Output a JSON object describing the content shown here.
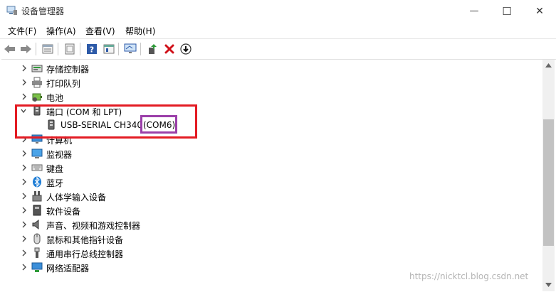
{
  "window": {
    "title": "设备管理器",
    "minimize_glyph": "—",
    "maximize_glyph": "☐",
    "close_glyph": "✕"
  },
  "menu": [
    {
      "label": "文件(F)"
    },
    {
      "label": "操作(A)"
    },
    {
      "label": "查看(V)"
    },
    {
      "label": "帮助(H)"
    }
  ],
  "toolbar": {
    "icons": [
      "back-icon",
      "forward-icon",
      "properties-icon",
      "update-icon",
      "help-icon",
      "show-hidden-icon",
      "scan-hardware-icon",
      "add-driver-icon",
      "uninstall-icon",
      "disable-icon"
    ]
  },
  "tree": {
    "items": [
      {
        "label": "存储控制器",
        "icon": "storage-controller-icon",
        "expanded": false
      },
      {
        "label": "打印队列",
        "icon": "print-queue-icon",
        "expanded": false
      },
      {
        "label": "电池",
        "icon": "battery-icon",
        "expanded": false
      },
      {
        "label": "端口 (COM 和 LPT)",
        "icon": "port-icon",
        "expanded": true
      },
      {
        "label": "USB-SERIAL CH340",
        "suffix": "(COM6)",
        "icon": "port-icon",
        "child": true
      },
      {
        "label": "计算机",
        "icon": "computer-icon",
        "expanded": false
      },
      {
        "label": "监视器",
        "icon": "monitor-icon",
        "expanded": false
      },
      {
        "label": "键盘",
        "icon": "keyboard-icon",
        "expanded": false
      },
      {
        "label": "蓝牙",
        "icon": "bluetooth-icon",
        "expanded": false
      },
      {
        "label": "人体学输入设备",
        "icon": "hid-icon",
        "expanded": false
      },
      {
        "label": "软件设备",
        "icon": "software-device-icon",
        "expanded": false
      },
      {
        "label": "声音、视频和游戏控制器",
        "icon": "sound-icon",
        "expanded": false
      },
      {
        "label": "鼠标和其他指针设备",
        "icon": "mouse-icon",
        "expanded": false
      },
      {
        "label": "通用串行总线控制器",
        "icon": "usb-icon",
        "expanded": false
      },
      {
        "label": "网络适配器",
        "icon": "network-icon",
        "expanded": false
      }
    ]
  },
  "watermark": "https://nicktcl.blog.csdn.net",
  "colors": {
    "highlight_red": "#e31b23",
    "highlight_purple": "#9b3fa9"
  }
}
